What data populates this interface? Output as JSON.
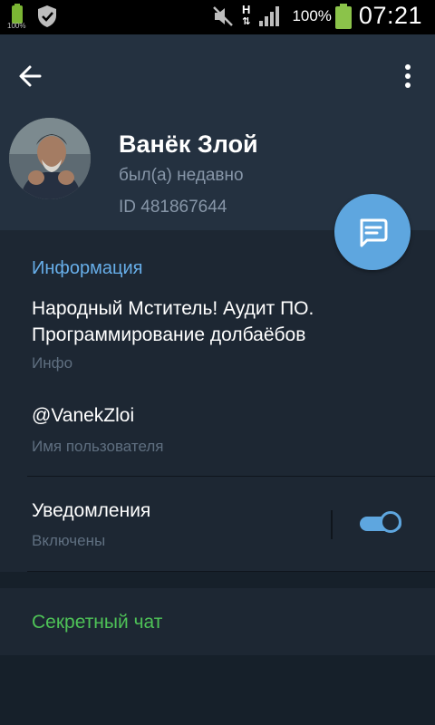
{
  "status_bar": {
    "battery_small_pct": "100%",
    "network": "H",
    "battery_pct": "100%",
    "time": "07:21"
  },
  "profile": {
    "name": "Ванёк Злой",
    "status": "был(а) недавно",
    "id": "ID 481867644"
  },
  "info": {
    "section_title": "Информация",
    "bio": "Народный Мститель! Аудит ПО. Программирование долбаёбов",
    "bio_label": "Инфо",
    "username": "@VanekZloi",
    "username_label": "Имя пользователя",
    "notifications_label": "Уведомления",
    "notifications_state": "Включены",
    "notifications_on": true
  },
  "secret_chat": {
    "label": "Секретный чат"
  },
  "colors": {
    "accent": "#5ea6df",
    "link": "#67aee9",
    "secret": "#4ec257",
    "background": "#1d2733",
    "header": "#243140"
  }
}
